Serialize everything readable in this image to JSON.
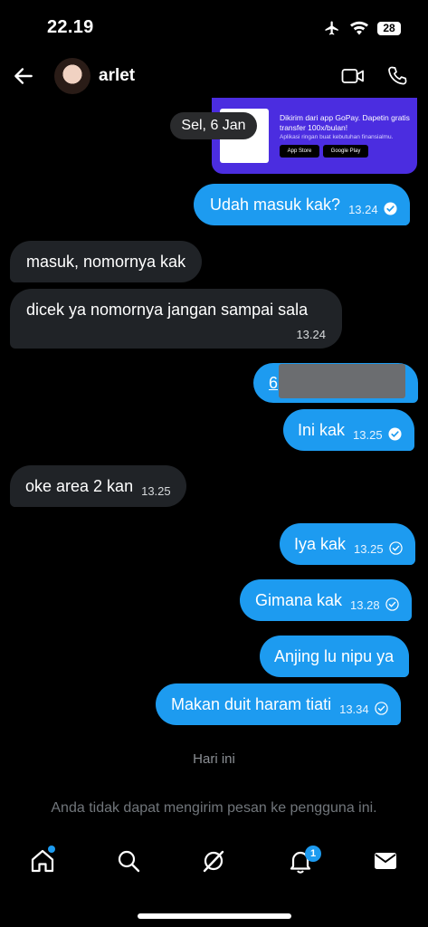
{
  "status_bar": {
    "time": "22.19",
    "battery": "28"
  },
  "header": {
    "name": "arlet"
  },
  "banner": {
    "title": "Dikirim dari app GoPay. Dapetin gratis transfer 100x/bulan!",
    "subtitle": "Aplikasi ringan buat kebutuhan finansialmu.",
    "app_store": "App Store",
    "google_play": "Google Play"
  },
  "date_chip": "Sel, 6 Jan",
  "messages": [
    {
      "text": "Udah masuk kak?",
      "time": "13.24"
    },
    {
      "text": "masuk, nomornya kak",
      "time": ""
    },
    {
      "text": "dicek ya nomornya jangan sampai sala",
      "time": "13.24"
    },
    {
      "text": "6",
      "time": ""
    },
    {
      "text": "Ini kak",
      "time": "13.25"
    },
    {
      "text": "oke area 2 kan",
      "time": "13.25"
    },
    {
      "text": "Iya kak",
      "time": "13.25"
    },
    {
      "text": "Gimana kak",
      "time": "13.28"
    },
    {
      "text": "Anjing lu nipu ya",
      "time": ""
    },
    {
      "text": "Makan duit haram tiati",
      "time": "13.34"
    }
  ],
  "divider": "Hari ini",
  "notice": "Anda tidak dapat mengirim pesan ke pengguna ini.",
  "nav": {
    "notifications_badge": "1"
  },
  "colors": {
    "accent": "#1d9bf0",
    "incoming": "#202327",
    "banner": "#4b2de0"
  }
}
